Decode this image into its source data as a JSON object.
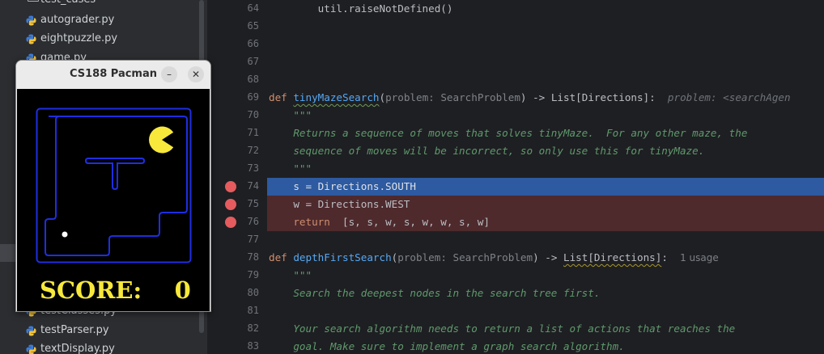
{
  "project_tree": {
    "items": [
      {
        "label": "test_cases",
        "kind": "folder"
      },
      {
        "label": "autograder.py",
        "kind": "python-file"
      },
      {
        "label": "eightpuzzle.py",
        "kind": "python-file"
      },
      {
        "label": "game.py",
        "kind": "python-file"
      },
      {
        "label": "testClasses.py",
        "kind": "python-file"
      },
      {
        "label": "testParser.py",
        "kind": "python-file"
      },
      {
        "label": "textDisplay.py",
        "kind": "python-file"
      }
    ],
    "colors": {
      "python_blue": "#3d7bd6",
      "python_yellow": "#f1c23c"
    }
  },
  "editor": {
    "line_numbers": [
      "64",
      "65",
      "66",
      "67",
      "68",
      "69",
      "70",
      "71",
      "72",
      "73",
      "74",
      "75",
      "76",
      "77",
      "78",
      "79",
      "80",
      "81",
      "82",
      "83"
    ],
    "lines": {
      "l64": "        util.raiseNotDefined()",
      "l69_def": "def ",
      "l69_fn": "tinyMazeSearch",
      "l69_open": "(",
      "l69_param": "problem: SearchProblem",
      "l69_close": ") -> ",
      "l69_type": "List[Directions]",
      "l69_colon": ":",
      "l69_hint": "problem: <searchAgen",
      "l70": "    \"\"\"",
      "l71": "    Returns a sequence of moves that solves tinyMaze.  For any other maze, the",
      "l72": "    sequence of moves will be incorrect, so only use this for tinyMaze.",
      "l73": "    \"\"\"",
      "l74": "    s = Directions.SOUTH",
      "l75": "    w = Directions.WEST",
      "l76_kw": "    return",
      "l76_rest": "  [s, s, w, s, w, w, s, w]",
      "l78_def": "def ",
      "l78_fn": "depthFirstSearch",
      "l78_open": "(",
      "l78_param": "problem: SearchProblem",
      "l78_close": ") -> ",
      "l78_type": "List[Directions]",
      "l78_colon": ":",
      "l78_usage": "1 usage",
      "l79": "    \"\"\"",
      "l80": "    Search the deepest nodes in the search tree first.",
      "l82": "    Your search algorithm needs to return a list of actions that reaches the",
      "l83": "    goal. Make sure to implement a graph search algorithm."
    },
    "breakpoint_lines": [
      "74",
      "75",
      "76"
    ],
    "current_line": "74",
    "colors": {
      "background": "#1e1f22",
      "current_line": "#2d5aa0",
      "breakpoint_line": "#4e2a2d",
      "breakpoint": "#e55b5e",
      "keyword": "#cf8e6d",
      "function": "#56a8f5",
      "docstring": "#5f9a6d"
    }
  },
  "pacman_window": {
    "title": "CS188 Pacman",
    "minimize_glyph": "–",
    "close_glyph": "✕",
    "score_label": "SCORE:",
    "score_value": "0",
    "colors": {
      "wall": "#1f2ee0",
      "pacman": "#f7e83b",
      "score": "#f7e83b",
      "food": "#ffffff"
    }
  }
}
